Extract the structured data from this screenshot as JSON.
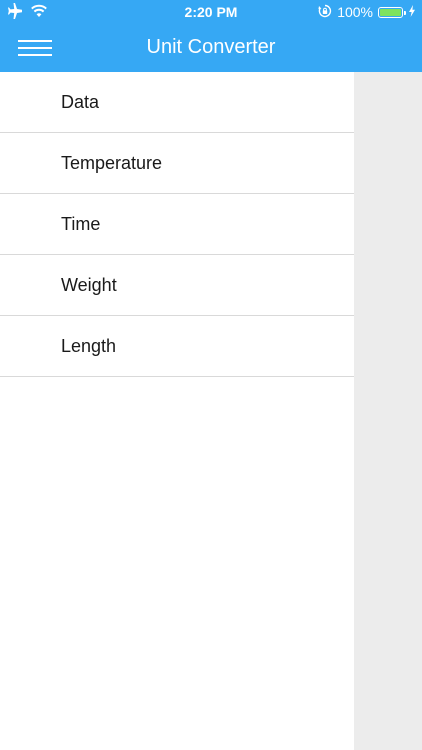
{
  "status_bar": {
    "time": "2:20 PM",
    "battery_text": "100%",
    "icons": [
      "airplane-icon",
      "wifi-icon",
      "orientation-lock-icon",
      "battery-icon",
      "charging-icon"
    ],
    "battery_fill_color": "#7ee35f"
  },
  "header": {
    "title": "Unit Converter",
    "background_color": "#36a8f4",
    "menu_icon": "hamburger-menu-icon"
  },
  "drawer": {
    "items": [
      {
        "label": "Data"
      },
      {
        "label": "Temperature"
      },
      {
        "label": "Time"
      },
      {
        "label": "Weight"
      },
      {
        "label": "Length"
      }
    ]
  }
}
